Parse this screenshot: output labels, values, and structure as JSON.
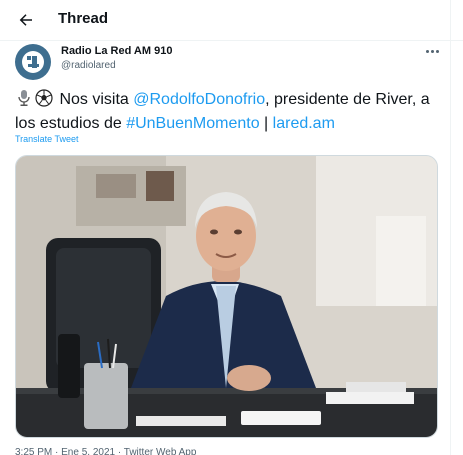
{
  "header": {
    "title": "Thread",
    "back_icon": "arrow-left-icon"
  },
  "tweet": {
    "author_name": "Radio La Red AM 910",
    "author_handle": "@radiolared",
    "avatar_icon": "radio-la-red-logo",
    "more_icon": "more-horizontal-icon",
    "emojis": [
      "studio-microphone-icon",
      "soccer-ball-icon"
    ],
    "text_1": " Nos visita ",
    "mention": "@RodolfoDonofrio",
    "text_2": ", presidente de River, a los estudios de ",
    "hashtag": "#UnBuenMomento",
    "text_3": " | ",
    "url": "lared.am",
    "translate_label": "Translate Tweet",
    "timestamp_partial": "3:25 PM · Ene 5, 2021 · Twitter Web App"
  },
  "colors": {
    "accent": "#1d9bf0",
    "text": "#0f1419",
    "muted": "#536471"
  }
}
